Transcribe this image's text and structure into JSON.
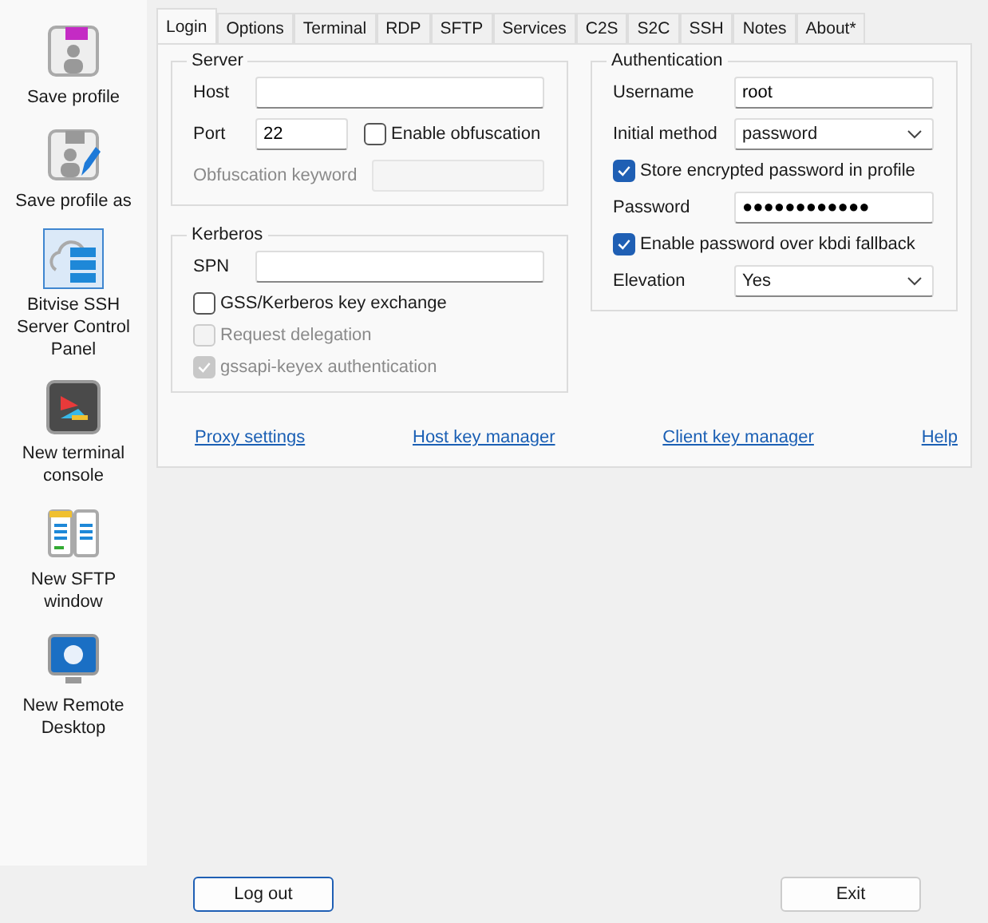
{
  "sidebar": {
    "items": [
      {
        "label": "Save profile",
        "selected": false
      },
      {
        "label": "Save profile as",
        "selected": false
      },
      {
        "label": "Bitvise SSH Server Control Panel",
        "selected": true
      },
      {
        "label": "New terminal console",
        "selected": false
      },
      {
        "label": "New SFTP window",
        "selected": false
      },
      {
        "label": "New Remote Desktop",
        "selected": false
      }
    ]
  },
  "tabs": [
    {
      "label": "Login",
      "selected": true
    },
    {
      "label": "Options",
      "selected": false
    },
    {
      "label": "Terminal",
      "selected": false
    },
    {
      "label": "RDP",
      "selected": false
    },
    {
      "label": "SFTP",
      "selected": false
    },
    {
      "label": "Services",
      "selected": false
    },
    {
      "label": "C2S",
      "selected": false
    },
    {
      "label": "S2C",
      "selected": false
    },
    {
      "label": "SSH",
      "selected": false
    },
    {
      "label": "Notes",
      "selected": false
    },
    {
      "label": "About*",
      "selected": false
    }
  ],
  "server": {
    "title": "Server",
    "host": {
      "label": "Host"
    },
    "port": {
      "label": "Port",
      "value": "22"
    },
    "obfuscation": {
      "label": "Enable obfuscation",
      "checked": false
    },
    "keyword": {
      "label": "Obfuscation keyword",
      "disabled": true
    }
  },
  "kerberos": {
    "title": "Kerberos",
    "spn": {
      "label": "SPN"
    },
    "checks": [
      {
        "label": "GSS/Kerberos key exchange",
        "checked": false,
        "disabled": false
      },
      {
        "label": "Request delegation",
        "checked": false,
        "disabled": true
      },
      {
        "label": "gssapi-keyex authentication",
        "checked": true,
        "disabled": true
      }
    ]
  },
  "authentication": {
    "title": "Authentication",
    "rows": [
      {
        "kind": "field",
        "label": "Username",
        "value": "root"
      },
      {
        "kind": "select",
        "label": "Initial method",
        "value": "password"
      },
      {
        "kind": "check",
        "label": "Store encrypted password in profile",
        "checked": true
      },
      {
        "kind": "field",
        "label": "Password",
        "value": "●●●●●●●●●●●●"
      },
      {
        "kind": "check",
        "label": "Enable password over kbdi fallback",
        "checked": true
      },
      {
        "kind": "select",
        "label": "Elevation",
        "value": "Yes"
      }
    ]
  },
  "links": [
    "Proxy settings",
    "Host key manager",
    "Client key manager",
    "Help"
  ],
  "buttons": [
    "Log out",
    "Exit"
  ]
}
